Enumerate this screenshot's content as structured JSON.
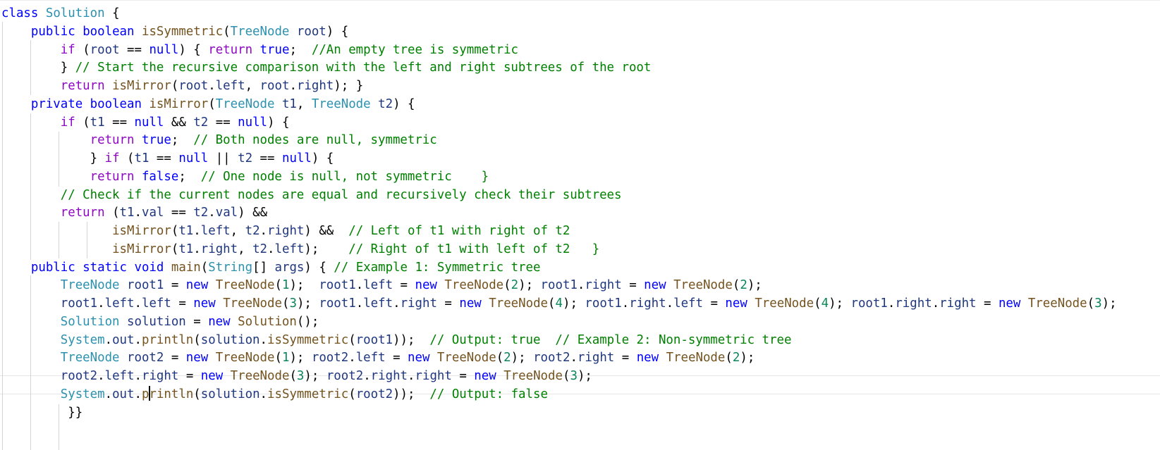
{
  "editor": {
    "language": "java",
    "cursor": {
      "line": 21,
      "column": 20
    },
    "lines": [
      [
        [
          "k",
          "class"
        ],
        [
          "p",
          " "
        ],
        [
          "t",
          "Solution"
        ],
        [
          "p",
          " {"
        ]
      ],
      [
        [
          "p",
          "    "
        ],
        [
          "k",
          "public"
        ],
        [
          "p",
          " "
        ],
        [
          "k",
          "boolean"
        ],
        [
          "p",
          " "
        ],
        [
          "m",
          "isSymmetric"
        ],
        [
          "p",
          "("
        ],
        [
          "t",
          "TreeNode"
        ],
        [
          "p",
          " "
        ],
        [
          "v",
          "root"
        ],
        [
          "p",
          ") {"
        ]
      ],
      [
        [
          "p",
          "        "
        ],
        [
          "c",
          "if"
        ],
        [
          "p",
          " ("
        ],
        [
          "v",
          "root"
        ],
        [
          "p",
          " == "
        ],
        [
          "k",
          "null"
        ],
        [
          "p",
          ") { "
        ],
        [
          "c",
          "return"
        ],
        [
          "p",
          " "
        ],
        [
          "k",
          "true"
        ],
        [
          "p",
          ";  "
        ],
        [
          "cm",
          "//An empty tree is symmetric"
        ]
      ],
      [
        [
          "p",
          "        } "
        ],
        [
          "cm",
          "// Start the recursive comparison with the left and right subtrees of the root"
        ]
      ],
      [
        [
          "p",
          "        "
        ],
        [
          "c",
          "return"
        ],
        [
          "p",
          " "
        ],
        [
          "m",
          "isMirror"
        ],
        [
          "p",
          "("
        ],
        [
          "v",
          "root"
        ],
        [
          "p",
          "."
        ],
        [
          "v",
          "left"
        ],
        [
          "p",
          ", "
        ],
        [
          "v",
          "root"
        ],
        [
          "p",
          "."
        ],
        [
          "v",
          "right"
        ],
        [
          "p",
          "); }"
        ]
      ],
      [
        [
          "p",
          "    "
        ],
        [
          "k",
          "private"
        ],
        [
          "p",
          " "
        ],
        [
          "k",
          "boolean"
        ],
        [
          "p",
          " "
        ],
        [
          "m",
          "isMirror"
        ],
        [
          "p",
          "("
        ],
        [
          "t",
          "TreeNode"
        ],
        [
          "p",
          " "
        ],
        [
          "v",
          "t1"
        ],
        [
          "p",
          ", "
        ],
        [
          "t",
          "TreeNode"
        ],
        [
          "p",
          " "
        ],
        [
          "v",
          "t2"
        ],
        [
          "p",
          ") {"
        ]
      ],
      [
        [
          "p",
          "        "
        ],
        [
          "c",
          "if"
        ],
        [
          "p",
          " ("
        ],
        [
          "v",
          "t1"
        ],
        [
          "p",
          " == "
        ],
        [
          "k",
          "null"
        ],
        [
          "p",
          " && "
        ],
        [
          "v",
          "t2"
        ],
        [
          "p",
          " == "
        ],
        [
          "k",
          "null"
        ],
        [
          "p",
          ") {"
        ]
      ],
      [
        [
          "p",
          "            "
        ],
        [
          "c",
          "return"
        ],
        [
          "p",
          " "
        ],
        [
          "k",
          "true"
        ],
        [
          "p",
          ";  "
        ],
        [
          "cm",
          "// Both nodes are null, symmetric"
        ]
      ],
      [
        [
          "p",
          "            } "
        ],
        [
          "c",
          "if"
        ],
        [
          "p",
          " ("
        ],
        [
          "v",
          "t1"
        ],
        [
          "p",
          " == "
        ],
        [
          "k",
          "null"
        ],
        [
          "p",
          " || "
        ],
        [
          "v",
          "t2"
        ],
        [
          "p",
          " == "
        ],
        [
          "k",
          "null"
        ],
        [
          "p",
          ") {"
        ]
      ],
      [
        [
          "p",
          "            "
        ],
        [
          "c",
          "return"
        ],
        [
          "p",
          " "
        ],
        [
          "k",
          "false"
        ],
        [
          "p",
          ";  "
        ],
        [
          "cm",
          "// One node is null, not symmetric    }"
        ]
      ],
      [
        [
          "p",
          "        "
        ],
        [
          "cm",
          "// Check if the current nodes are equal and recursively check their subtrees"
        ]
      ],
      [
        [
          "p",
          "        "
        ],
        [
          "c",
          "return"
        ],
        [
          "p",
          " ("
        ],
        [
          "v",
          "t1"
        ],
        [
          "p",
          "."
        ],
        [
          "v",
          "val"
        ],
        [
          "p",
          " == "
        ],
        [
          "v",
          "t2"
        ],
        [
          "p",
          "."
        ],
        [
          "v",
          "val"
        ],
        [
          "p",
          ") &&"
        ]
      ],
      [
        [
          "p",
          "               "
        ],
        [
          "m",
          "isMirror"
        ],
        [
          "p",
          "("
        ],
        [
          "v",
          "t1"
        ],
        [
          "p",
          "."
        ],
        [
          "v",
          "left"
        ],
        [
          "p",
          ", "
        ],
        [
          "v",
          "t2"
        ],
        [
          "p",
          "."
        ],
        [
          "v",
          "right"
        ],
        [
          "p",
          ") &&  "
        ],
        [
          "cm",
          "// Left of t1 with right of t2"
        ]
      ],
      [
        [
          "p",
          "               "
        ],
        [
          "m",
          "isMirror"
        ],
        [
          "p",
          "("
        ],
        [
          "v",
          "t1"
        ],
        [
          "p",
          "."
        ],
        [
          "v",
          "right"
        ],
        [
          "p",
          ", "
        ],
        [
          "v",
          "t2"
        ],
        [
          "p",
          "."
        ],
        [
          "v",
          "left"
        ],
        [
          "p",
          ");    "
        ],
        [
          "cm",
          "// Right of t1 with left of t2   }"
        ]
      ],
      [
        [
          "p",
          "    "
        ],
        [
          "k",
          "public"
        ],
        [
          "p",
          " "
        ],
        [
          "k",
          "static"
        ],
        [
          "p",
          " "
        ],
        [
          "k",
          "void"
        ],
        [
          "p",
          " "
        ],
        [
          "m",
          "main"
        ],
        [
          "p",
          "("
        ],
        [
          "t",
          "String"
        ],
        [
          "p",
          "[] "
        ],
        [
          "v",
          "args"
        ],
        [
          "p",
          ") { "
        ],
        [
          "cm",
          "// Example 1: Symmetric tree"
        ]
      ],
      [
        [
          "p",
          "        "
        ],
        [
          "t",
          "TreeNode"
        ],
        [
          "p",
          " "
        ],
        [
          "v",
          "root1"
        ],
        [
          "p",
          " = "
        ],
        [
          "k",
          "new"
        ],
        [
          "p",
          " "
        ],
        [
          "m",
          "TreeNode"
        ],
        [
          "p",
          "("
        ],
        [
          "n",
          "1"
        ],
        [
          "p",
          ");  "
        ],
        [
          "v",
          "root1"
        ],
        [
          "p",
          "."
        ],
        [
          "v",
          "left"
        ],
        [
          "p",
          " = "
        ],
        [
          "k",
          "new"
        ],
        [
          "p",
          " "
        ],
        [
          "m",
          "TreeNode"
        ],
        [
          "p",
          "("
        ],
        [
          "n",
          "2"
        ],
        [
          "p",
          "); "
        ],
        [
          "v",
          "root1"
        ],
        [
          "p",
          "."
        ],
        [
          "v",
          "right"
        ],
        [
          "p",
          " = "
        ],
        [
          "k",
          "new"
        ],
        [
          "p",
          " "
        ],
        [
          "m",
          "TreeNode"
        ],
        [
          "p",
          "("
        ],
        [
          "n",
          "2"
        ],
        [
          "p",
          ");"
        ]
      ],
      [
        [
          "p",
          "        "
        ],
        [
          "v",
          "root1"
        ],
        [
          "p",
          "."
        ],
        [
          "v",
          "left"
        ],
        [
          "p",
          "."
        ],
        [
          "v",
          "left"
        ],
        [
          "p",
          " = "
        ],
        [
          "k",
          "new"
        ],
        [
          "p",
          " "
        ],
        [
          "m",
          "TreeNode"
        ],
        [
          "p",
          "("
        ],
        [
          "n",
          "3"
        ],
        [
          "p",
          "); "
        ],
        [
          "v",
          "root1"
        ],
        [
          "p",
          "."
        ],
        [
          "v",
          "left"
        ],
        [
          "p",
          "."
        ],
        [
          "v",
          "right"
        ],
        [
          "p",
          " = "
        ],
        [
          "k",
          "new"
        ],
        [
          "p",
          " "
        ],
        [
          "m",
          "TreeNode"
        ],
        [
          "p",
          "("
        ],
        [
          "n",
          "4"
        ],
        [
          "p",
          "); "
        ],
        [
          "v",
          "root1"
        ],
        [
          "p",
          "."
        ],
        [
          "v",
          "right"
        ],
        [
          "p",
          "."
        ],
        [
          "v",
          "left"
        ],
        [
          "p",
          " = "
        ],
        [
          "k",
          "new"
        ],
        [
          "p",
          " "
        ],
        [
          "m",
          "TreeNode"
        ],
        [
          "p",
          "("
        ],
        [
          "n",
          "4"
        ],
        [
          "p",
          "); "
        ],
        [
          "v",
          "root1"
        ],
        [
          "p",
          "."
        ],
        [
          "v",
          "right"
        ],
        [
          "p",
          "."
        ],
        [
          "v",
          "right"
        ],
        [
          "p",
          " = "
        ],
        [
          "k",
          "new"
        ],
        [
          "p",
          " "
        ],
        [
          "m",
          "TreeNode"
        ],
        [
          "p",
          "("
        ],
        [
          "n",
          "3"
        ],
        [
          "p",
          ");"
        ]
      ],
      [
        [
          "p",
          "        "
        ],
        [
          "t",
          "Solution"
        ],
        [
          "p",
          " "
        ],
        [
          "v",
          "solution"
        ],
        [
          "p",
          " = "
        ],
        [
          "k",
          "new"
        ],
        [
          "p",
          " "
        ],
        [
          "m",
          "Solution"
        ],
        [
          "p",
          "();"
        ]
      ],
      [
        [
          "p",
          "        "
        ],
        [
          "t",
          "System"
        ],
        [
          "p",
          "."
        ],
        [
          "v",
          "out"
        ],
        [
          "p",
          "."
        ],
        [
          "m",
          "println"
        ],
        [
          "p",
          "("
        ],
        [
          "v",
          "solution"
        ],
        [
          "p",
          "."
        ],
        [
          "m",
          "isSymmetric"
        ],
        [
          "p",
          "("
        ],
        [
          "v",
          "root1"
        ],
        [
          "p",
          "));  "
        ],
        [
          "cm",
          "// Output: true  // Example 2: Non-symmetric tree"
        ]
      ],
      [
        [
          "p",
          "        "
        ],
        [
          "t",
          "TreeNode"
        ],
        [
          "p",
          " "
        ],
        [
          "v",
          "root2"
        ],
        [
          "p",
          " = "
        ],
        [
          "k",
          "new"
        ],
        [
          "p",
          " "
        ],
        [
          "m",
          "TreeNode"
        ],
        [
          "p",
          "("
        ],
        [
          "n",
          "1"
        ],
        [
          "p",
          "); "
        ],
        [
          "v",
          "root2"
        ],
        [
          "p",
          "."
        ],
        [
          "v",
          "left"
        ],
        [
          "p",
          " = "
        ],
        [
          "k",
          "new"
        ],
        [
          "p",
          " "
        ],
        [
          "m",
          "TreeNode"
        ],
        [
          "p",
          "("
        ],
        [
          "n",
          "2"
        ],
        [
          "p",
          "); "
        ],
        [
          "v",
          "root2"
        ],
        [
          "p",
          "."
        ],
        [
          "v",
          "right"
        ],
        [
          "p",
          " = "
        ],
        [
          "k",
          "new"
        ],
        [
          "p",
          " "
        ],
        [
          "m",
          "TreeNode"
        ],
        [
          "p",
          "("
        ],
        [
          "n",
          "2"
        ],
        [
          "p",
          ");"
        ]
      ],
      [
        [
          "p",
          "        "
        ],
        [
          "v",
          "root2"
        ],
        [
          "p",
          "."
        ],
        [
          "v",
          "left"
        ],
        [
          "p",
          "."
        ],
        [
          "v",
          "right"
        ],
        [
          "p",
          " = "
        ],
        [
          "k",
          "new"
        ],
        [
          "p",
          " "
        ],
        [
          "m",
          "TreeNode"
        ],
        [
          "p",
          "("
        ],
        [
          "n",
          "3"
        ],
        [
          "p",
          "); "
        ],
        [
          "v",
          "root2"
        ],
        [
          "p",
          "."
        ],
        [
          "v",
          "right"
        ],
        [
          "p",
          "."
        ],
        [
          "v",
          "right"
        ],
        [
          "p",
          " = "
        ],
        [
          "k",
          "new"
        ],
        [
          "p",
          " "
        ],
        [
          "m",
          "TreeNode"
        ],
        [
          "p",
          "("
        ],
        [
          "n",
          "3"
        ],
        [
          "p",
          ");"
        ]
      ],
      [
        [
          "p",
          "        "
        ],
        [
          "t",
          "System"
        ],
        [
          "p",
          "."
        ],
        [
          "v",
          "out"
        ],
        [
          "p",
          "."
        ],
        [
          "m",
          "println"
        ],
        [
          "p",
          "("
        ],
        [
          "v",
          "solution"
        ],
        [
          "p",
          "."
        ],
        [
          "m",
          "isSymmetric"
        ],
        [
          "p",
          "("
        ],
        [
          "v",
          "root2"
        ],
        [
          "p",
          "));  "
        ],
        [
          "cm",
          "// Output: false"
        ]
      ],
      [
        [
          "p",
          "         }}"
        ]
      ]
    ]
  }
}
